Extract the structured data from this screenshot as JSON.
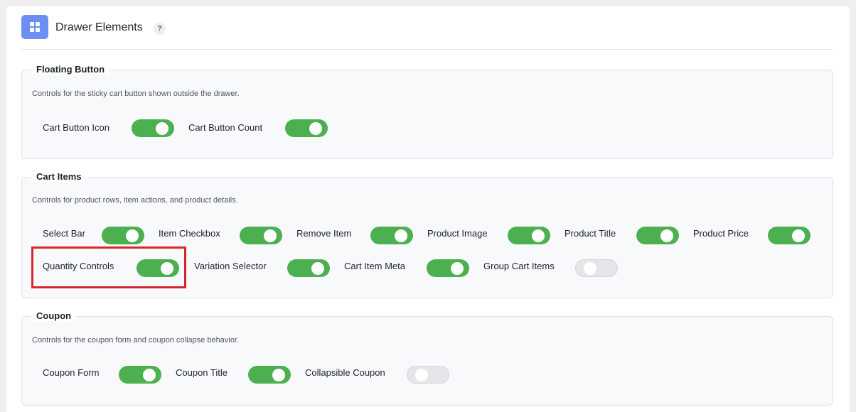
{
  "header": {
    "title": "Drawer Elements",
    "help": "?",
    "icon": "grid-icon",
    "accent_color": "#6b8ff5"
  },
  "sections": {
    "floating": {
      "title": "Floating Button",
      "desc": "Controls for the sticky cart button shown outside the drawer.",
      "options": [
        {
          "label": "Cart Button Icon",
          "on": true
        },
        {
          "label": "Cart Button Count",
          "on": true
        }
      ]
    },
    "cart_items": {
      "title": "Cart Items",
      "desc": "Controls for product rows, item actions, and product details.",
      "options": [
        {
          "label": "Select Bar",
          "on": true
        },
        {
          "label": "Item Checkbox",
          "on": true
        },
        {
          "label": "Remove Item",
          "on": true
        },
        {
          "label": "Product Image",
          "on": true
        },
        {
          "label": "Product Title",
          "on": true
        },
        {
          "label": "Product Price",
          "on": true
        },
        {
          "label": "Quantity Controls",
          "on": true
        },
        {
          "label": "Variation Selector",
          "on": true
        },
        {
          "label": "Cart Item Meta",
          "on": true
        },
        {
          "label": "Group Cart Items",
          "on": false
        }
      ]
    },
    "coupon": {
      "title": "Coupon",
      "desc": "Controls for the coupon form and coupon collapse behavior.",
      "options": [
        {
          "label": "Coupon Form",
          "on": true
        },
        {
          "label": "Coupon Title",
          "on": true
        },
        {
          "label": "Collapsible Coupon",
          "on": false
        }
      ]
    }
  },
  "colors": {
    "toggle_on": "#4caf50",
    "toggle_off": "#e4e6e8",
    "highlight": "#d9262c"
  }
}
